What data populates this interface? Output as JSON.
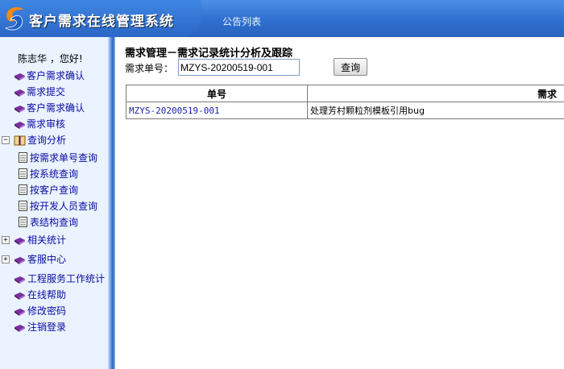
{
  "header": {
    "app_title": "客户需求在线管理系统",
    "notice_link": "公告列表"
  },
  "sidebar": {
    "greeting": "陈志华 ，您好!",
    "items": [
      {
        "label": "客户需求确认",
        "icon": "book-icon"
      },
      {
        "label": "需求提交",
        "icon": "book-icon"
      },
      {
        "label": "客户需求确认",
        "icon": "book-icon"
      },
      {
        "label": "需求审核",
        "icon": "book-icon"
      }
    ],
    "query_group": {
      "label": "查询分析",
      "toggle": "−",
      "icon": "open-book-icon",
      "children": [
        {
          "label": "按需求单号查询",
          "icon": "page-icon"
        },
        {
          "label": "按系统查询",
          "icon": "page-icon"
        },
        {
          "label": "按客户查询",
          "icon": "page-icon"
        },
        {
          "label": "按开发人员查询",
          "icon": "page-icon"
        },
        {
          "label": "表结构查询",
          "icon": "page-icon"
        }
      ]
    },
    "stats_group": {
      "label": "相关统计",
      "toggle": "+",
      "icon": "book-icon"
    },
    "service_group": {
      "label": "客服中心",
      "toggle": "+",
      "icon": "book-icon"
    },
    "bottom_items": [
      {
        "label": "工程服务工作统计",
        "icon": "book-icon"
      },
      {
        "label": "在线帮助",
        "icon": "book-icon"
      },
      {
        "label": "修改密码",
        "icon": "book-icon"
      },
      {
        "label": "注销登录",
        "icon": "book-icon"
      }
    ]
  },
  "main": {
    "title": "需求管理－需求记录统计分析及跟踪",
    "search_label": "需求单号：",
    "search_value": "MZYS-20200519-001",
    "search_button": "查询",
    "table": {
      "headers": [
        "单号",
        "需求"
      ],
      "rows": [
        [
          "MZYS-20200519-001",
          "处理芳村颗粒剂模板引用bug"
        ]
      ]
    }
  },
  "colors": {
    "header_blue": "#2f6fcf",
    "sidebar_bg": "#eaf3ff",
    "link_blue": "#0a0aa0"
  }
}
